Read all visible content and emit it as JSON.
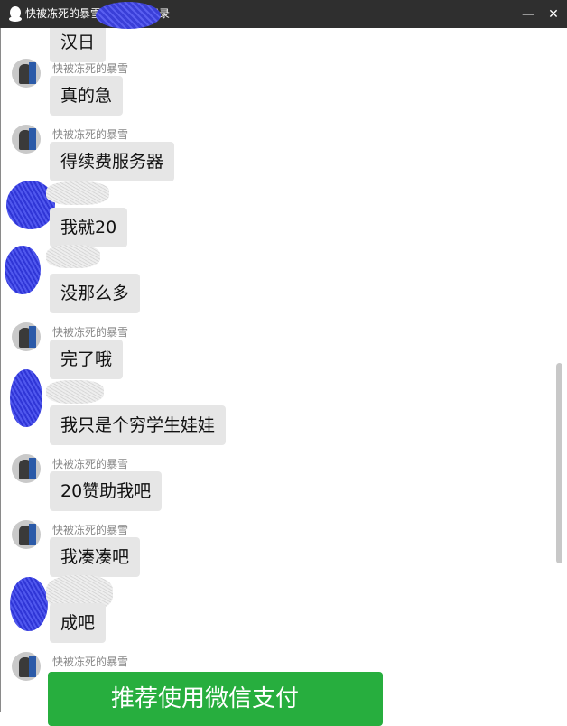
{
  "window": {
    "title_prefix": "快被冻死的暴雪",
    "title_suffix": "天记录",
    "minimize_label": "—",
    "close_label": "✕"
  },
  "other_name": "快被冻死的暴雪",
  "messages": [
    {
      "sender": "partial",
      "text": "汉日"
    },
    {
      "sender": "other",
      "name": "快被冻死的暴雪",
      "text": "真的急"
    },
    {
      "sender": "other",
      "name": "快被冻死的暴雪",
      "text": "得续费服务器"
    },
    {
      "sender": "me",
      "text": "我就20"
    },
    {
      "sender": "me",
      "text": "没那么多"
    },
    {
      "sender": "other",
      "name": "快被冻死的暴雪",
      "text": "完了哦"
    },
    {
      "sender": "me",
      "text": "我只是个穷学生娃娃"
    },
    {
      "sender": "other",
      "name": "快被冻死的暴雪",
      "text": "20赞助我吧"
    },
    {
      "sender": "other",
      "name": "快被冻死的暴雪",
      "text": "我凑凑吧"
    },
    {
      "sender": "me",
      "text": "成吧"
    },
    {
      "sender": "other",
      "name": "快被冻死的暴雪",
      "text": ""
    }
  ],
  "wechat_card": {
    "text": "推荐使用微信支付"
  },
  "colors": {
    "titlebar": "#2f2f2f",
    "bubble": "#e6e6e6",
    "card": "#27ae3e",
    "redaction": "#3a3fd8"
  }
}
